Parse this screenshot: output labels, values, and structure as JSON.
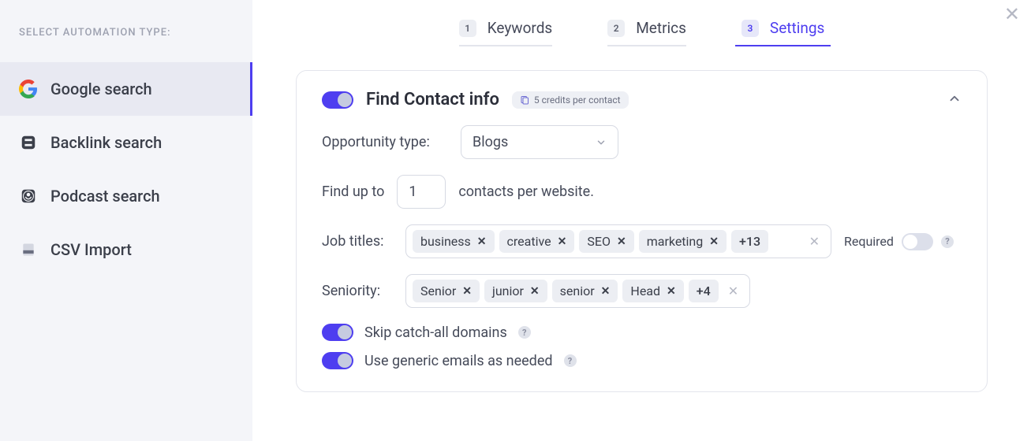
{
  "sidebar": {
    "title": "SELECT AUTOMATION TYPE:",
    "items": [
      {
        "label": "Google search",
        "active": true
      },
      {
        "label": "Backlink search",
        "active": false
      },
      {
        "label": "Podcast search",
        "active": false
      },
      {
        "label": "CSV Import",
        "active": false
      }
    ]
  },
  "tabs": [
    {
      "num": "1",
      "label": "Keywords",
      "active": false
    },
    {
      "num": "2",
      "label": "Metrics",
      "active": false
    },
    {
      "num": "3",
      "label": "Settings",
      "active": true
    }
  ],
  "card": {
    "title": "Find Contact info",
    "badge": "5 credits per contact",
    "opportunity_label": "Opportunity type:",
    "opportunity_value": "Blogs",
    "findup_prefix": "Find up to",
    "findup_value": "1",
    "findup_suffix": "contacts per website.",
    "jobtitles_label": "Job titles:",
    "jobtitles": [
      "business",
      "creative",
      "SEO",
      "marketing"
    ],
    "jobtitles_more": "+13",
    "required_label": "Required",
    "seniority_label": "Seniority:",
    "seniority": [
      "Senior",
      "junior",
      "senior",
      "Head"
    ],
    "seniority_more": "+4",
    "skip_label": "Skip catch-all domains",
    "generic_label": "Use generic emails as needed"
  }
}
